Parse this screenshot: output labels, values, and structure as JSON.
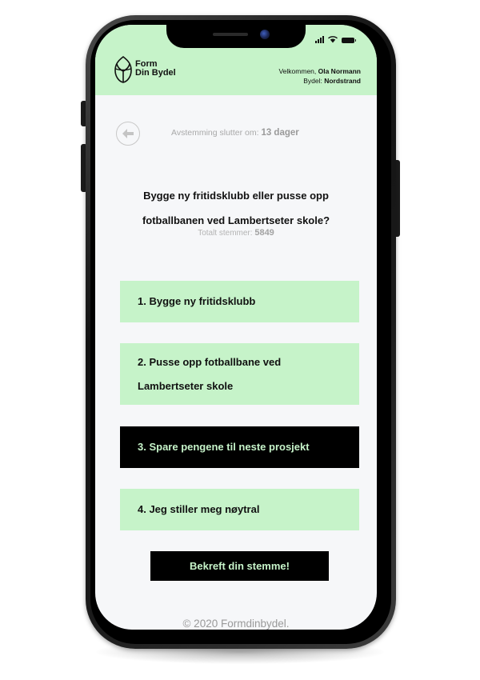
{
  "brand": {
    "line1": "Form",
    "line2": "Din Bydel"
  },
  "header": {
    "welcome_prefix": "Velkommen, ",
    "user_name": "Ola Normann",
    "district_prefix": "Bydel: ",
    "district_name": "Nordstrand"
  },
  "status_bar": {
    "icons": [
      "signal-icon",
      "wifi-icon",
      "battery-icon"
    ]
  },
  "poll": {
    "deadline_label": "Avstemming slutter om: ",
    "deadline_value": "13 dager",
    "question": "Bygge ny fritidsklubb eller pusse opp fotballbanen ved Lambertseter skole?",
    "total_label": "Totalt stemmer: ",
    "total_value": "5849",
    "options": [
      {
        "label": "1. Bygge ny fritidsklubb",
        "selected": false
      },
      {
        "label": "2. Pusse opp fotballbane ved Lambertseter skole",
        "selected": false
      },
      {
        "label": "3. Spare pengene til neste prosjekt",
        "selected": true
      },
      {
        "label": "4. Jeg stiller meg nøytral",
        "selected": false
      }
    ],
    "confirm_label": "Bekreft din stemme!"
  },
  "footer": {
    "text": "© 2020 Formdinbydel."
  },
  "colors": {
    "accent_green": "#c6f3c9",
    "selected_bg": "#000000",
    "screen_bg": "#f6f7f9",
    "muted_text": "#a9a9a9"
  }
}
